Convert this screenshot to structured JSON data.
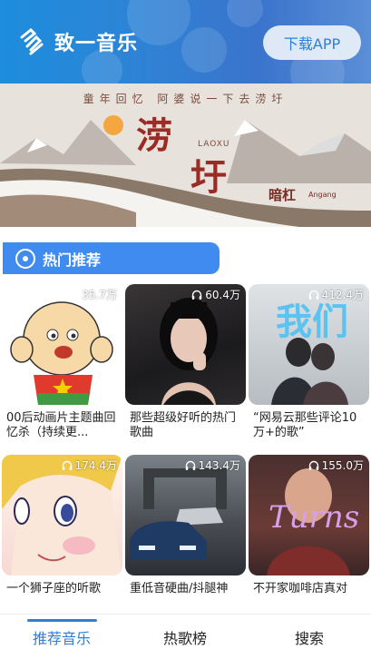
{
  "header": {
    "app_title": "致一音乐",
    "download_label": "下载APP",
    "accent": "#2f7ed8"
  },
  "banner": {
    "top_text": "童年回忆 阿婆说一下去涝圩",
    "title_line1": "涝",
    "title_line2": "圩",
    "title_en": "LAOXU",
    "artist": "暗杠",
    "artist_en": "Angang"
  },
  "section": {
    "title": "热门推荐",
    "icon": "disc-icon"
  },
  "playlists": [
    {
      "count": "35.7万",
      "title": "00后动画片主题曲回忆杀（持续更..."
    },
    {
      "count": "60.4万",
      "title": "那些超级好听的热门歌曲"
    },
    {
      "count": "412.4万",
      "title": "“网易云那些评论10万+的歌”"
    },
    {
      "count": "174.4万",
      "title": "一个狮子座的听歌"
    },
    {
      "count": "143.4万",
      "title": "重低音硬曲/抖腿神"
    },
    {
      "count": "155.0万",
      "title": "不开家咖啡店真对"
    }
  ],
  "tabs": [
    {
      "label": "推荐音乐",
      "active": true
    },
    {
      "label": "热歌榜",
      "active": false
    },
    {
      "label": "搜索",
      "active": false
    }
  ]
}
